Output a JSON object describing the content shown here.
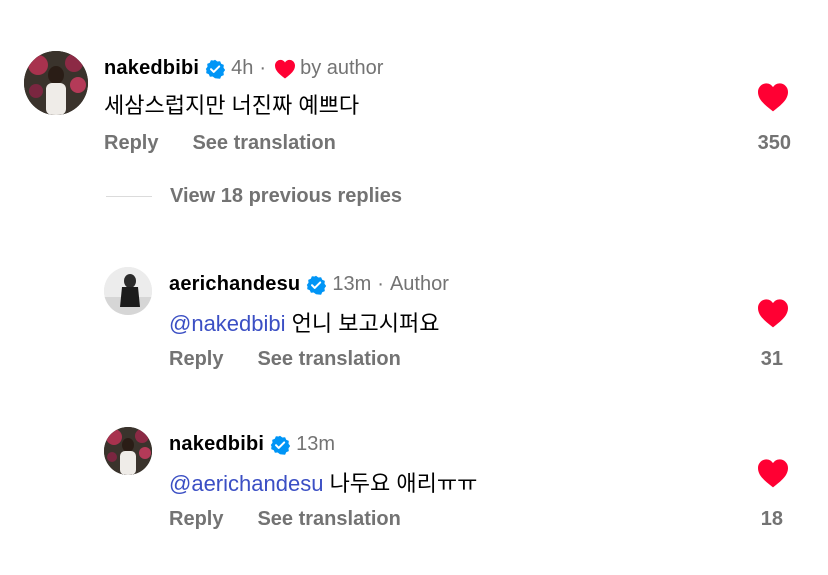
{
  "comments": [
    {
      "username": "nakedbibi",
      "time": "4h",
      "separator": "·",
      "liked_by_author_text": "by author",
      "text": "세삼스럽지만 너진짜 예쁘다",
      "reply_label": "Reply",
      "translate_label": "See translation",
      "likes": "350"
    },
    {
      "username": "aerichandesu",
      "time": "13m",
      "separator": "·",
      "author_tag": "Author",
      "mention": "@nakedbibi",
      "text": "언니 보고시퍼요",
      "reply_label": "Reply",
      "translate_label": "See translation",
      "likes": "31"
    },
    {
      "username": "nakedbibi",
      "time": "13m",
      "mention": "@aerichandesu",
      "text": "나두요 애리ㅠㅠ",
      "reply_label": "Reply",
      "translate_label": "See translation",
      "likes": "18"
    }
  ],
  "view_replies_label": "View 18 previous replies",
  "colors": {
    "heart": "#ff0033",
    "verified": "#0095f6",
    "secondary_text": "#737373",
    "mention": "#3b4fc4"
  },
  "icons": [
    "verified-badge-icon",
    "heart-icon"
  ]
}
